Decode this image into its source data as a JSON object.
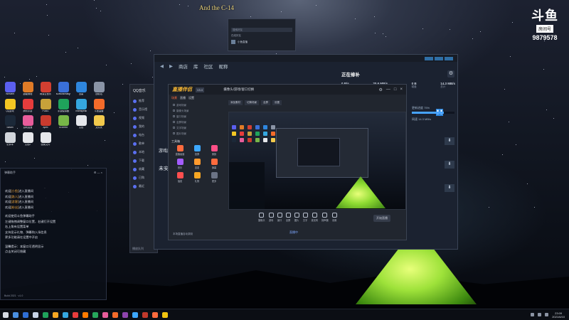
{
  "overlay": {
    "title": "And the  C-14",
    "subtitle": ""
  },
  "brand": {
    "logo": "斗鱼",
    "room_label": "房间号",
    "room_number": "9879578"
  },
  "desktop_icons": [
    {
      "label": "WeMeet",
      "color": "#5b5ff0"
    },
    {
      "label": "超级管理",
      "color": "#e07b27"
    },
    {
      "label": "网易云音乐",
      "color": "#d23f31"
    },
    {
      "label": "sDesctikmator",
      "color": "#3a6fd8"
    },
    {
      "label": "迅雷",
      "color": "#2e86de"
    },
    {
      "label": "回收站",
      "color": "#8a94a6"
    },
    {
      "label": "QQ游戏",
      "color": "#f3c623"
    },
    {
      "label": "腾讯手游",
      "color": "#e63c3c"
    },
    {
      "label": "PUBG",
      "color": "#c7a23a"
    },
    {
      "label": "手游模拟器",
      "color": "#1fa35b"
    },
    {
      "label": "Teamspeak",
      "color": "#35a7e0"
    },
    {
      "label": "斗鱼直播",
      "color": "#f56b2a"
    },
    {
      "label": "Steam",
      "color": "#1b2838"
    },
    {
      "label": "游戏加速",
      "color": "#e85d9b"
    },
    {
      "label": "Apex",
      "color": "#c93b2e"
    },
    {
      "label": "uTorrent",
      "color": "#78b648"
    },
    {
      "label": "文档",
      "color": "#e5e7eb"
    },
    {
      "label": "文件夹",
      "color": "#f2c94c"
    },
    {
      "label": "记事本",
      "color": "#d1d5db"
    },
    {
      "label": "文档2",
      "color": "#e5e7eb"
    },
    {
      "label": "配置文件",
      "color": "#e5e7eb"
    }
  ],
  "chat": {
    "header_left": "弹幕助手",
    "header_right": "⚙ — ×",
    "messages": [
      {
        "pre": "欢迎",
        "name": "[小鱼]",
        "post": "进入直播间"
      },
      {
        "pre": "欢迎",
        "name": "[路人]",
        "post": "进入直播间"
      },
      {
        "pre": "欢迎",
        "name": "[游客]",
        "post": "进入直播间"
      },
      {
        "pre": "欢迎",
        "name": "[粉丝]",
        "post": "进入直播间"
      }
    ],
    "notes": [
      "欢迎使用斗鱼弹幕助手",
      "左键拖拽调整窗口位置，右键打开设置",
      "右上角有设置菜单",
      "支持显示礼物、弹幕和入场信息",
      "更多功能请在设置中开启"
    ],
    "notes2": [
      "温馨提示：本窗口可透明显示",
      "点击关闭可隐藏"
    ],
    "footer": "Build 2021 · v1.0"
  },
  "qq": {
    "title": "QQ音乐",
    "items": [
      "推荐",
      "音乐馆",
      "视频",
      "我的",
      "电台",
      "歌单",
      "本地",
      "下载",
      "收藏",
      "已购",
      "最近"
    ],
    "bottom": "播放队列"
  },
  "steam": {
    "nav": [
      "商店",
      "库",
      "社区",
      "昵称"
    ],
    "downloading_title": "正在修补",
    "stats": [
      {
        "label": "当前",
        "value": "0 B/s"
      },
      {
        "label": "峰值",
        "value": "20.6 MB/s"
      },
      {
        "label": "磁盘",
        "value": "0 B"
      },
      {
        "label": "总计",
        "value": "14.3 MB/s"
      }
    ],
    "speed_line": "网速 14.3 MB/s",
    "library_label": "未安装",
    "library_label2": "游戏库",
    "progress_label": "更新进度 75%",
    "progress": 0.75,
    "download_icon": "download-icon"
  },
  "friends": {
    "search": "搜索好友",
    "group": "在线好友",
    "friend": "小鱼直播"
  },
  "obs": {
    "brand": "直播伴侣",
    "version": "V5.0",
    "title": "摄像头/游戏/窗口切换",
    "tabs": [
      "场景",
      "直播",
      "设置"
    ],
    "scenes": [
      "游戏场景",
      "摄像头场景",
      "窗口场景",
      "全屏场景",
      "文字场景",
      "图片场景"
    ],
    "section_tools": "工具箱",
    "tools": [
      {
        "label": "直播画面",
        "color": "#ff6b3d"
      },
      {
        "label": "投屏",
        "color": "#3da8ff"
      },
      {
        "label": "美颜",
        "color": "#ff4f87"
      },
      {
        "label": "音乐",
        "color": "#a45cff"
      },
      {
        "label": "连麦",
        "color": "#ff9a2e"
      },
      {
        "label": "弹幕",
        "color": "#ff6b3d"
      },
      {
        "label": "抽奖",
        "color": "#ff4f4f"
      },
      {
        "label": "礼物",
        "color": "#f5a623"
      },
      {
        "label": "更多",
        "color": "#6c7486"
      }
    ],
    "toolbar": [
      "添加素材",
      "切换场景",
      "全屏",
      "设置"
    ],
    "controls": [
      "摄像头",
      "游戏",
      "窗口",
      "全屏",
      "图片",
      "文字",
      "麦克风",
      "扬声器",
      "设置"
    ],
    "start_label": "开始直播",
    "live_link": "直播中",
    "check_label": "本场直播自动录制"
  },
  "taskbar": {
    "icons": [
      "#4a90e2",
      "#2f6fd6",
      "#c6d3e6",
      "#1fa35b",
      "#f5a623",
      "#35a7e0",
      "#e63c3c",
      "#ff7a00",
      "#26a65b",
      "#e85d9b",
      "#f56b2a",
      "#8e44ad",
      "#3da8ff",
      "#c0392b",
      "#ff6b3d",
      "#f1c40f"
    ],
    "clock_time": "23:09",
    "clock_date": "2021/6/10"
  }
}
